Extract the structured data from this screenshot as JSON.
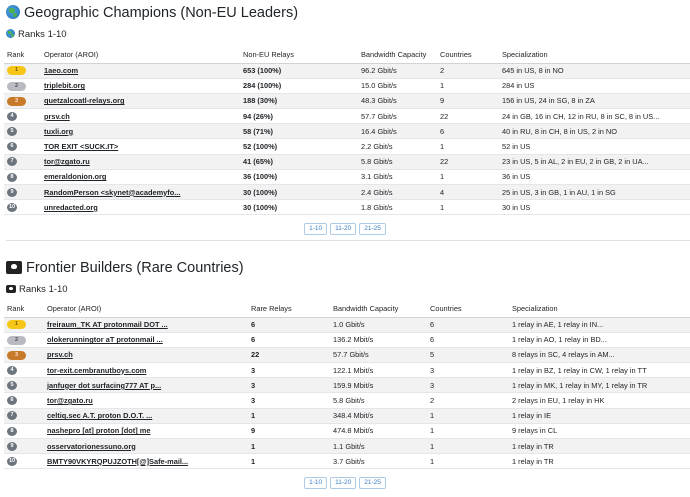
{
  "sections": [
    {
      "title": "Geographic Champions (Non-EU Leaders)",
      "subtitle": "Ranks 1-10",
      "icon": "globe-icon",
      "headers": [
        "Rank",
        "Operator (AROI)",
        "Non-EU Relays",
        "Bandwidth Capacity",
        "Countries",
        "Specialization"
      ],
      "rows": [
        {
          "rank": "1",
          "operator": "1aeo.com",
          "relays": "653 (100%)",
          "bandwidth": "96.2 Gbit/s",
          "countries": "2",
          "spec": "645 in US, 8 in NO"
        },
        {
          "rank": "2",
          "operator": "triplebit.org",
          "relays": "284 (100%)",
          "bandwidth": "15.0 Gbit/s",
          "countries": "1",
          "spec": "284 in US"
        },
        {
          "rank": "3",
          "operator": "quetzalcoatl-relays.org",
          "relays": "188 (30%)",
          "bandwidth": "48.3 Gbit/s",
          "countries": "9",
          "spec": "156 in US, 24 in SG, 8 in ZA"
        },
        {
          "rank": "4",
          "operator": "prsv.ch",
          "relays": "94 (26%)",
          "bandwidth": "57.7 Gbit/s",
          "countries": "22",
          "spec": "24 in GB, 16 in CH, 12 in RU, 8 in SC, 8 in US..."
        },
        {
          "rank": "5",
          "operator": "tuxli.org",
          "relays": "58 (71%)",
          "bandwidth": "16.4 Gbit/s",
          "countries": "6",
          "spec": "40 in RU, 8 in CH, 8 in US, 2 in NO"
        },
        {
          "rank": "6",
          "operator": "TOR EXIT <SUCK.IT>",
          "relays": "52 (100%)",
          "bandwidth": "2.2 Gbit/s",
          "countries": "1",
          "spec": "52 in US"
        },
        {
          "rank": "7",
          "operator": "tor@zgato.ru",
          "relays": "41 (65%)",
          "bandwidth": "5.8 Gbit/s",
          "countries": "22",
          "spec": "23 in US, 5 in AL, 2 in EU, 2 in GB, 2 in UA..."
        },
        {
          "rank": "8",
          "operator": "emeraldonion.org",
          "relays": "36 (100%)",
          "bandwidth": "3.1 Gbit/s",
          "countries": "1",
          "spec": "36 in US"
        },
        {
          "rank": "9",
          "operator": "RandomPerson <skynet@academyfo...",
          "relays": "30 (100%)",
          "bandwidth": "2.4 Gbit/s",
          "countries": "4",
          "spec": "25 in US, 3 in GB, 1 in AU, 1 in SG"
        },
        {
          "rank": "10",
          "operator": "unredacted.org",
          "relays": "30 (100%)",
          "bandwidth": "1.8 Gbit/s",
          "countries": "1",
          "spec": "30 in US"
        }
      ],
      "pages": [
        "1-10",
        "11-20",
        "21-25"
      ]
    },
    {
      "title": "Frontier Builders (Rare Countries)",
      "subtitle": "Ranks 1-10",
      "icon": "pirate-flag-icon",
      "headers": [
        "Rank",
        "Operator (AROI)",
        "Rare Relays",
        "Bandwidth Capacity",
        "Countries",
        "Specialization"
      ],
      "rows": [
        {
          "rank": "1",
          "operator": "freiraum_TK AT protonmail DOT ...",
          "relays": "6",
          "bandwidth": "1.0 Gbit/s",
          "countries": "6",
          "spec": "1 relay in AE, 1 relay in IN..."
        },
        {
          "rank": "2",
          "operator": "olokerunningtor aT protonmail ...",
          "relays": "6",
          "bandwidth": "136.2 Mbit/s",
          "countries": "6",
          "spec": "1 relay in AO, 1 relay in BD..."
        },
        {
          "rank": "3",
          "operator": "prsv.ch",
          "relays": "22",
          "bandwidth": "57.7 Gbit/s",
          "countries": "5",
          "spec": "8 relays in SC, 4 relays in AM..."
        },
        {
          "rank": "4",
          "operator": "tor-exit.cembranutboys.com",
          "relays": "3",
          "bandwidth": "122.1 Mbit/s",
          "countries": "3",
          "spec": "1 relay in BZ, 1 relay in CW, 1 relay in TT"
        },
        {
          "rank": "5",
          "operator": "janfuger dot surfacing777 AT p...",
          "relays": "3",
          "bandwidth": "159.9 Mbit/s",
          "countries": "3",
          "spec": "1 relay in MK, 1 relay in MY, 1 relay in TR"
        },
        {
          "rank": "6",
          "operator": "tor@zgato.ru",
          "relays": "3",
          "bandwidth": "5.8 Gbit/s",
          "countries": "2",
          "spec": "2 relays in EU, 1 relay in HK"
        },
        {
          "rank": "7",
          "operator": "celtiq.sec A.T. proton D.O.T. ...",
          "relays": "1",
          "bandwidth": "348.4 Mbit/s",
          "countries": "1",
          "spec": "1 relay in IE"
        },
        {
          "rank": "8",
          "operator": "nashepro [at] proton [dot] me",
          "relays": "9",
          "bandwidth": "474.8 Mbit/s",
          "countries": "1",
          "spec": "9 relays in CL"
        },
        {
          "rank": "9",
          "operator": "osservatorionessuno.org",
          "relays": "1",
          "bandwidth": "1.1 Gbit/s",
          "countries": "1",
          "spec": "1 relay in TR"
        },
        {
          "rank": "10",
          "operator": "BMTY90VKYRQPUJZOTH[@]Safe-mail...",
          "relays": "1",
          "bandwidth": "3.7 Gbit/s",
          "countries": "1",
          "spec": "1 relay in TR"
        }
      ],
      "pages": [
        "1-10",
        "11-20",
        "21-25"
      ]
    }
  ]
}
